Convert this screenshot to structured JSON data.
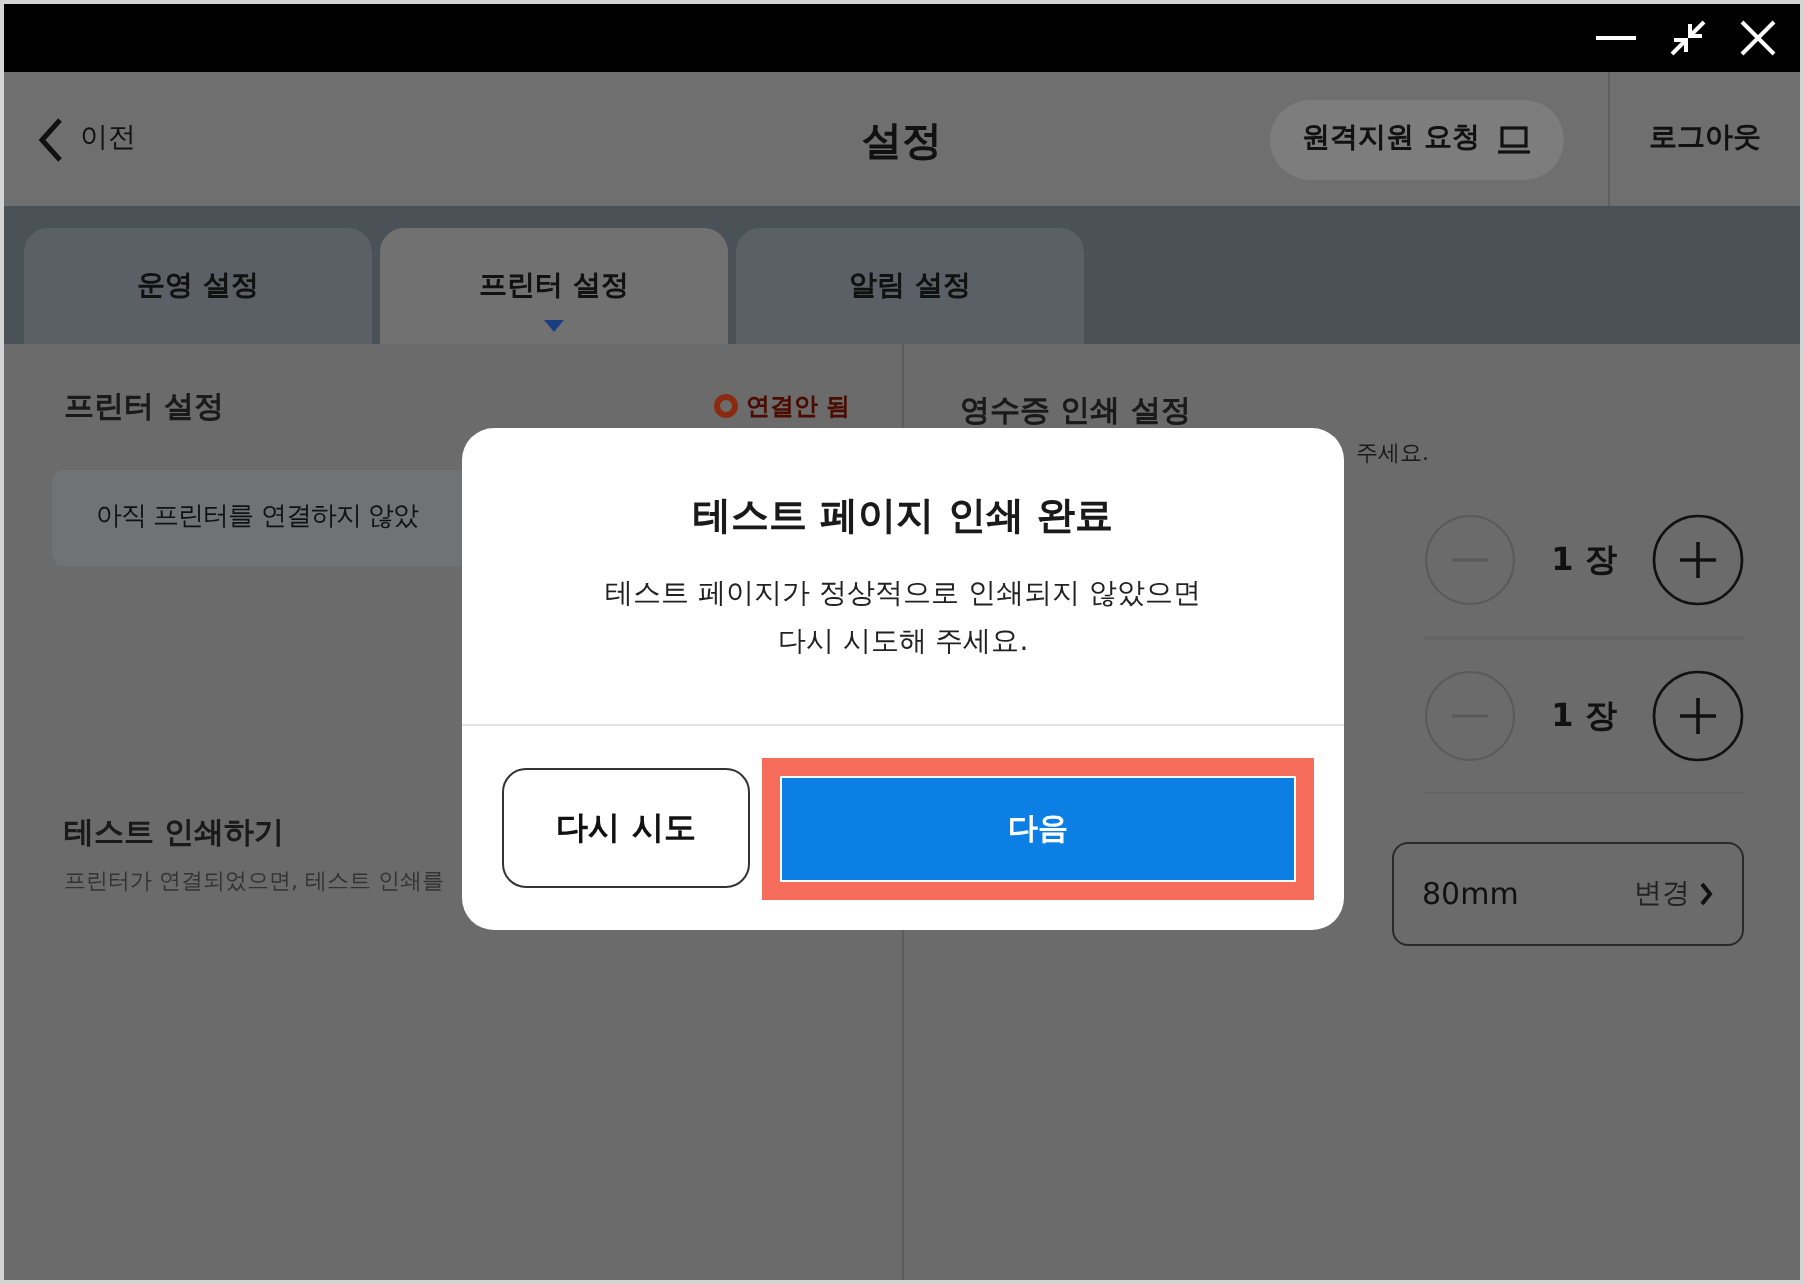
{
  "header": {
    "back_label": "이전",
    "title": "설정",
    "remote_button": "원격지원 요청",
    "logout": "로그아웃"
  },
  "tabs": [
    {
      "label": "운영 설정",
      "selected": false
    },
    {
      "label": "프린터 설정",
      "selected": true
    },
    {
      "label": "알림 설정",
      "selected": false
    }
  ],
  "printer_section": {
    "title": "프린터 설정",
    "status": "연결안 됨",
    "message": "아직 프린터를 연결하지 않았"
  },
  "test_print": {
    "title": "테스트 인쇄하기",
    "description": "프린터가 연결되었으면, 테스트 인쇄를"
  },
  "receipt_section": {
    "title": "영수증 인쇄 설정",
    "hint": "주세요.",
    "counters": [
      {
        "value": "1 장"
      },
      {
        "value": "1 장"
      }
    ],
    "paper": {
      "value": "80mm",
      "action": "변경"
    }
  },
  "dialog": {
    "title": "테스트 페이지 인쇄 완료",
    "message_lines": [
      "테스트 페이지가 정상적으로 인쇄되지 않았으면",
      "다시 시도해 주세요."
    ],
    "buttons": [
      {
        "label": "다시 시도",
        "kind": "secondary",
        "highlighted": false
      },
      {
        "label": "다음",
        "kind": "primary",
        "highlighted": true
      }
    ]
  }
}
